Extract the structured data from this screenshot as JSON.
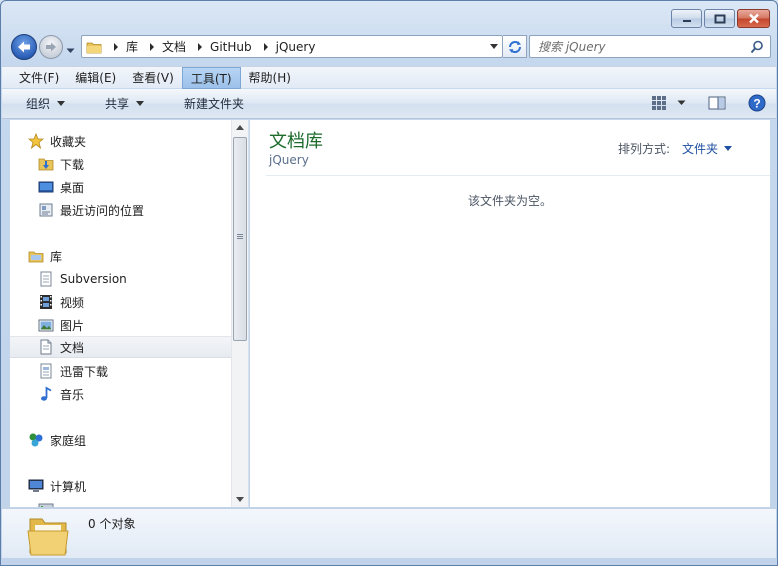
{
  "window": {
    "caption_buttons": [
      "minimize",
      "maximize",
      "close"
    ]
  },
  "address": {
    "breadcrumbs": [
      "库",
      "文档",
      "GitHub",
      "jQuery"
    ],
    "search_placeholder": "搜索 jQuery"
  },
  "menu": {
    "items": [
      {
        "label": "文件(F)",
        "active": false
      },
      {
        "label": "编辑(E)",
        "active": false
      },
      {
        "label": "查看(V)",
        "active": false
      },
      {
        "label": "工具(T)",
        "active": true
      },
      {
        "label": "帮助(H)",
        "active": false
      }
    ]
  },
  "commands": {
    "organize": "组织",
    "share": "共享",
    "new_folder": "新建文件夹"
  },
  "nav": {
    "favorites_header": "收藏夹",
    "favorites": [
      "下载",
      "桌面",
      "最近访问的位置"
    ],
    "libraries_header": "库",
    "libraries": [
      "Subversion",
      "视频",
      "图片",
      "文档",
      "迅雷下载",
      "音乐"
    ],
    "selected": "文档",
    "homegroup": "家庭组",
    "computer": "计算机"
  },
  "content": {
    "library_title": "文档库",
    "library_subtitle": "jQuery",
    "arrange_label": "排列方式:",
    "arrange_value": "文件夹",
    "empty_message": "该文件夹为空。"
  },
  "details": {
    "item_count": "0 个对象"
  },
  "colors": {
    "title_green": "#1c6b2b",
    "link_blue": "#1f4fa1",
    "menu_active": "#9cc1ea"
  }
}
